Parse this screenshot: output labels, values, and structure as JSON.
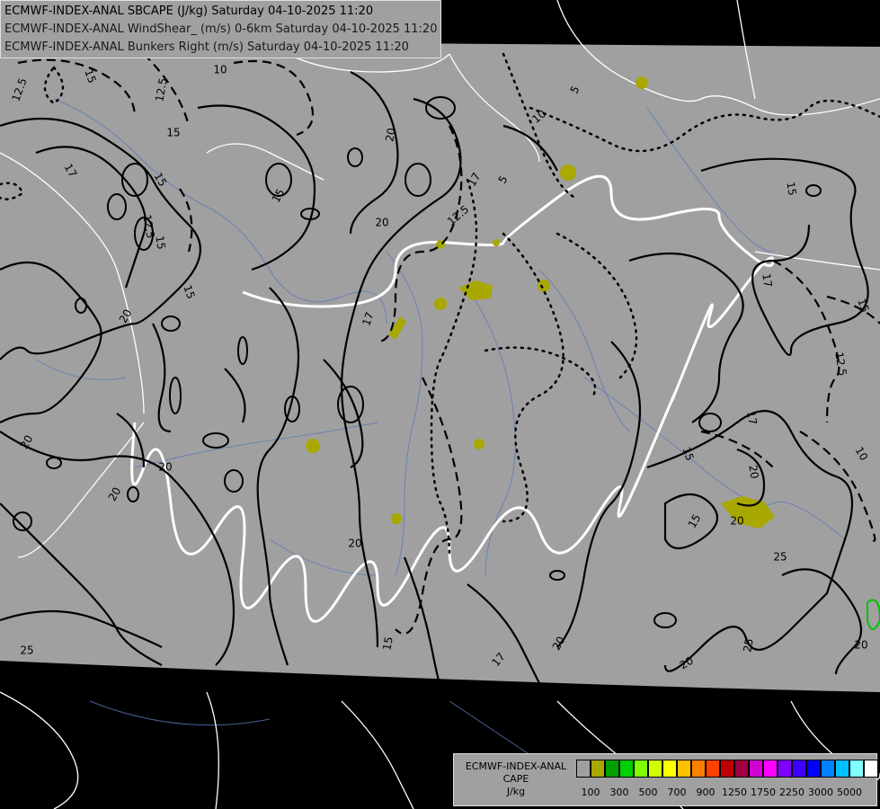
{
  "header": {
    "line1": "ECMWF-INDEX-ANAL SBCAPE (J/kg) Saturday 04-10-2025 11:20",
    "line2": "ECMWF-INDEX-ANAL WindShear_ (m/s) 0-6km Saturday 04-10-2025 11:20",
    "line3": "ECMWF-INDEX-ANAL Bunkers Right (m/s) Saturday 04-10-2025 11:20"
  },
  "legend": {
    "title1": "ECMWF-INDEX-ANAL",
    "title2": "CAPE",
    "title3": "J/kg",
    "colors": [
      "#a0a0a0",
      "#a8a800",
      "#00a000",
      "#00d000",
      "#80ff00",
      "#d0ff00",
      "#ffff00",
      "#ffc000",
      "#ff8000",
      "#ff4000",
      "#c00000",
      "#a00040",
      "#d000d0",
      "#ff00ff",
      "#8000ff",
      "#4000ff",
      "#0000ff",
      "#0080ff",
      "#00c0ff",
      "#80ffff",
      "#ffffff"
    ],
    "ticks": [
      "100",
      "300",
      "500",
      "700",
      "900",
      "1250",
      "1750",
      "2250",
      "3000",
      "5000"
    ]
  },
  "contour_labels": [
    {
      "text": "12.5"
    },
    {
      "text": "15"
    },
    {
      "text": "10"
    },
    {
      "text": "12.5"
    },
    {
      "text": "15"
    },
    {
      "text": "17"
    },
    {
      "text": "15"
    },
    {
      "text": "12.5"
    },
    {
      "text": "15"
    },
    {
      "text": "15"
    },
    {
      "text": "20"
    },
    {
      "text": "20"
    },
    {
      "text": "15"
    },
    {
      "text": "20"
    },
    {
      "text": "20"
    },
    {
      "text": "17"
    },
    {
      "text": "20"
    },
    {
      "text": "17"
    },
    {
      "text": "12.5"
    },
    {
      "text": "5"
    },
    {
      "text": "5"
    },
    {
      "text": "10"
    },
    {
      "text": "15"
    },
    {
      "text": "15"
    },
    {
      "text": "17"
    },
    {
      "text": "12.5"
    },
    {
      "text": "10"
    },
    {
      "text": "17"
    },
    {
      "text": "15"
    },
    {
      "text": "20"
    },
    {
      "text": "15"
    },
    {
      "text": "20"
    },
    {
      "text": "20"
    },
    {
      "text": "20"
    },
    {
      "text": "25"
    },
    {
      "text": "15"
    },
    {
      "text": "17"
    },
    {
      "text": "20"
    },
    {
      "text": "25"
    },
    {
      "text": "20"
    },
    {
      "text": "25"
    },
    {
      "text": "20"
    }
  ]
}
